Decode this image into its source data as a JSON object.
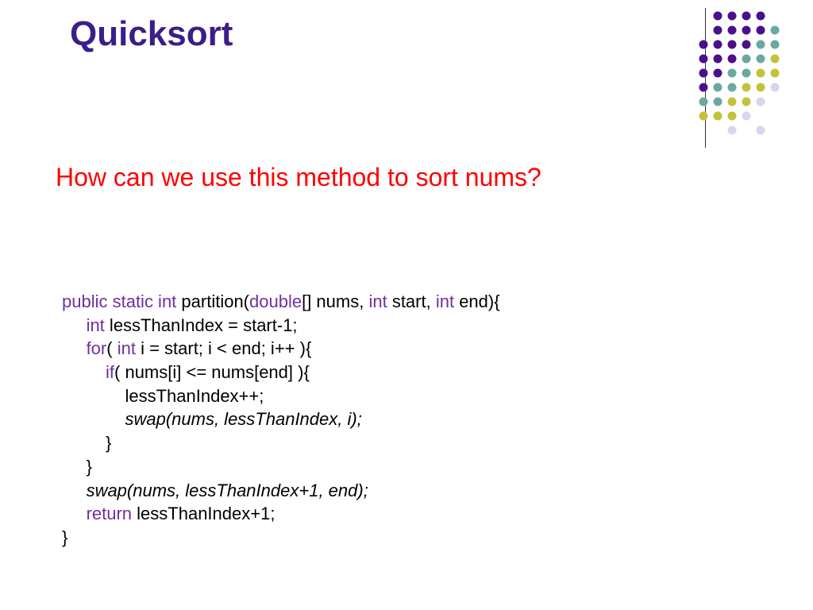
{
  "title": "Quicksort",
  "question": "How can we use this method to sort nums?",
  "code": {
    "l1a": "public static int",
    "l1b": " partition(",
    "l1c": "double",
    "l1d": "[] nums, ",
    "l1e": "int",
    "l1f": " start, ",
    "l1g": "int",
    "l1h": " end){",
    "l2a": "int",
    "l2b": " lessThanIndex = start-1;",
    "l3a": "for",
    "l3b": "( ",
    "l3c": "int",
    "l3d": " i = start; i < end; i++ ){",
    "l4a": "if",
    "l4b": "( nums[i] <= nums[end] ){",
    "l5": "lessThanIndex++;",
    "l6": "swap(nums, lessThanIndex, i);",
    "l7": "}",
    "l8": "}",
    "l9": "swap(nums, lessThanIndex+1, end);",
    "l10a": "return",
    "l10b": " lessThanIndex+1;",
    "l11": "}"
  },
  "colors": {
    "purple": "#4b0f8c",
    "teal": "#6aa9a2",
    "olive": "#c2c23c",
    "light": "#d6d6ec"
  }
}
